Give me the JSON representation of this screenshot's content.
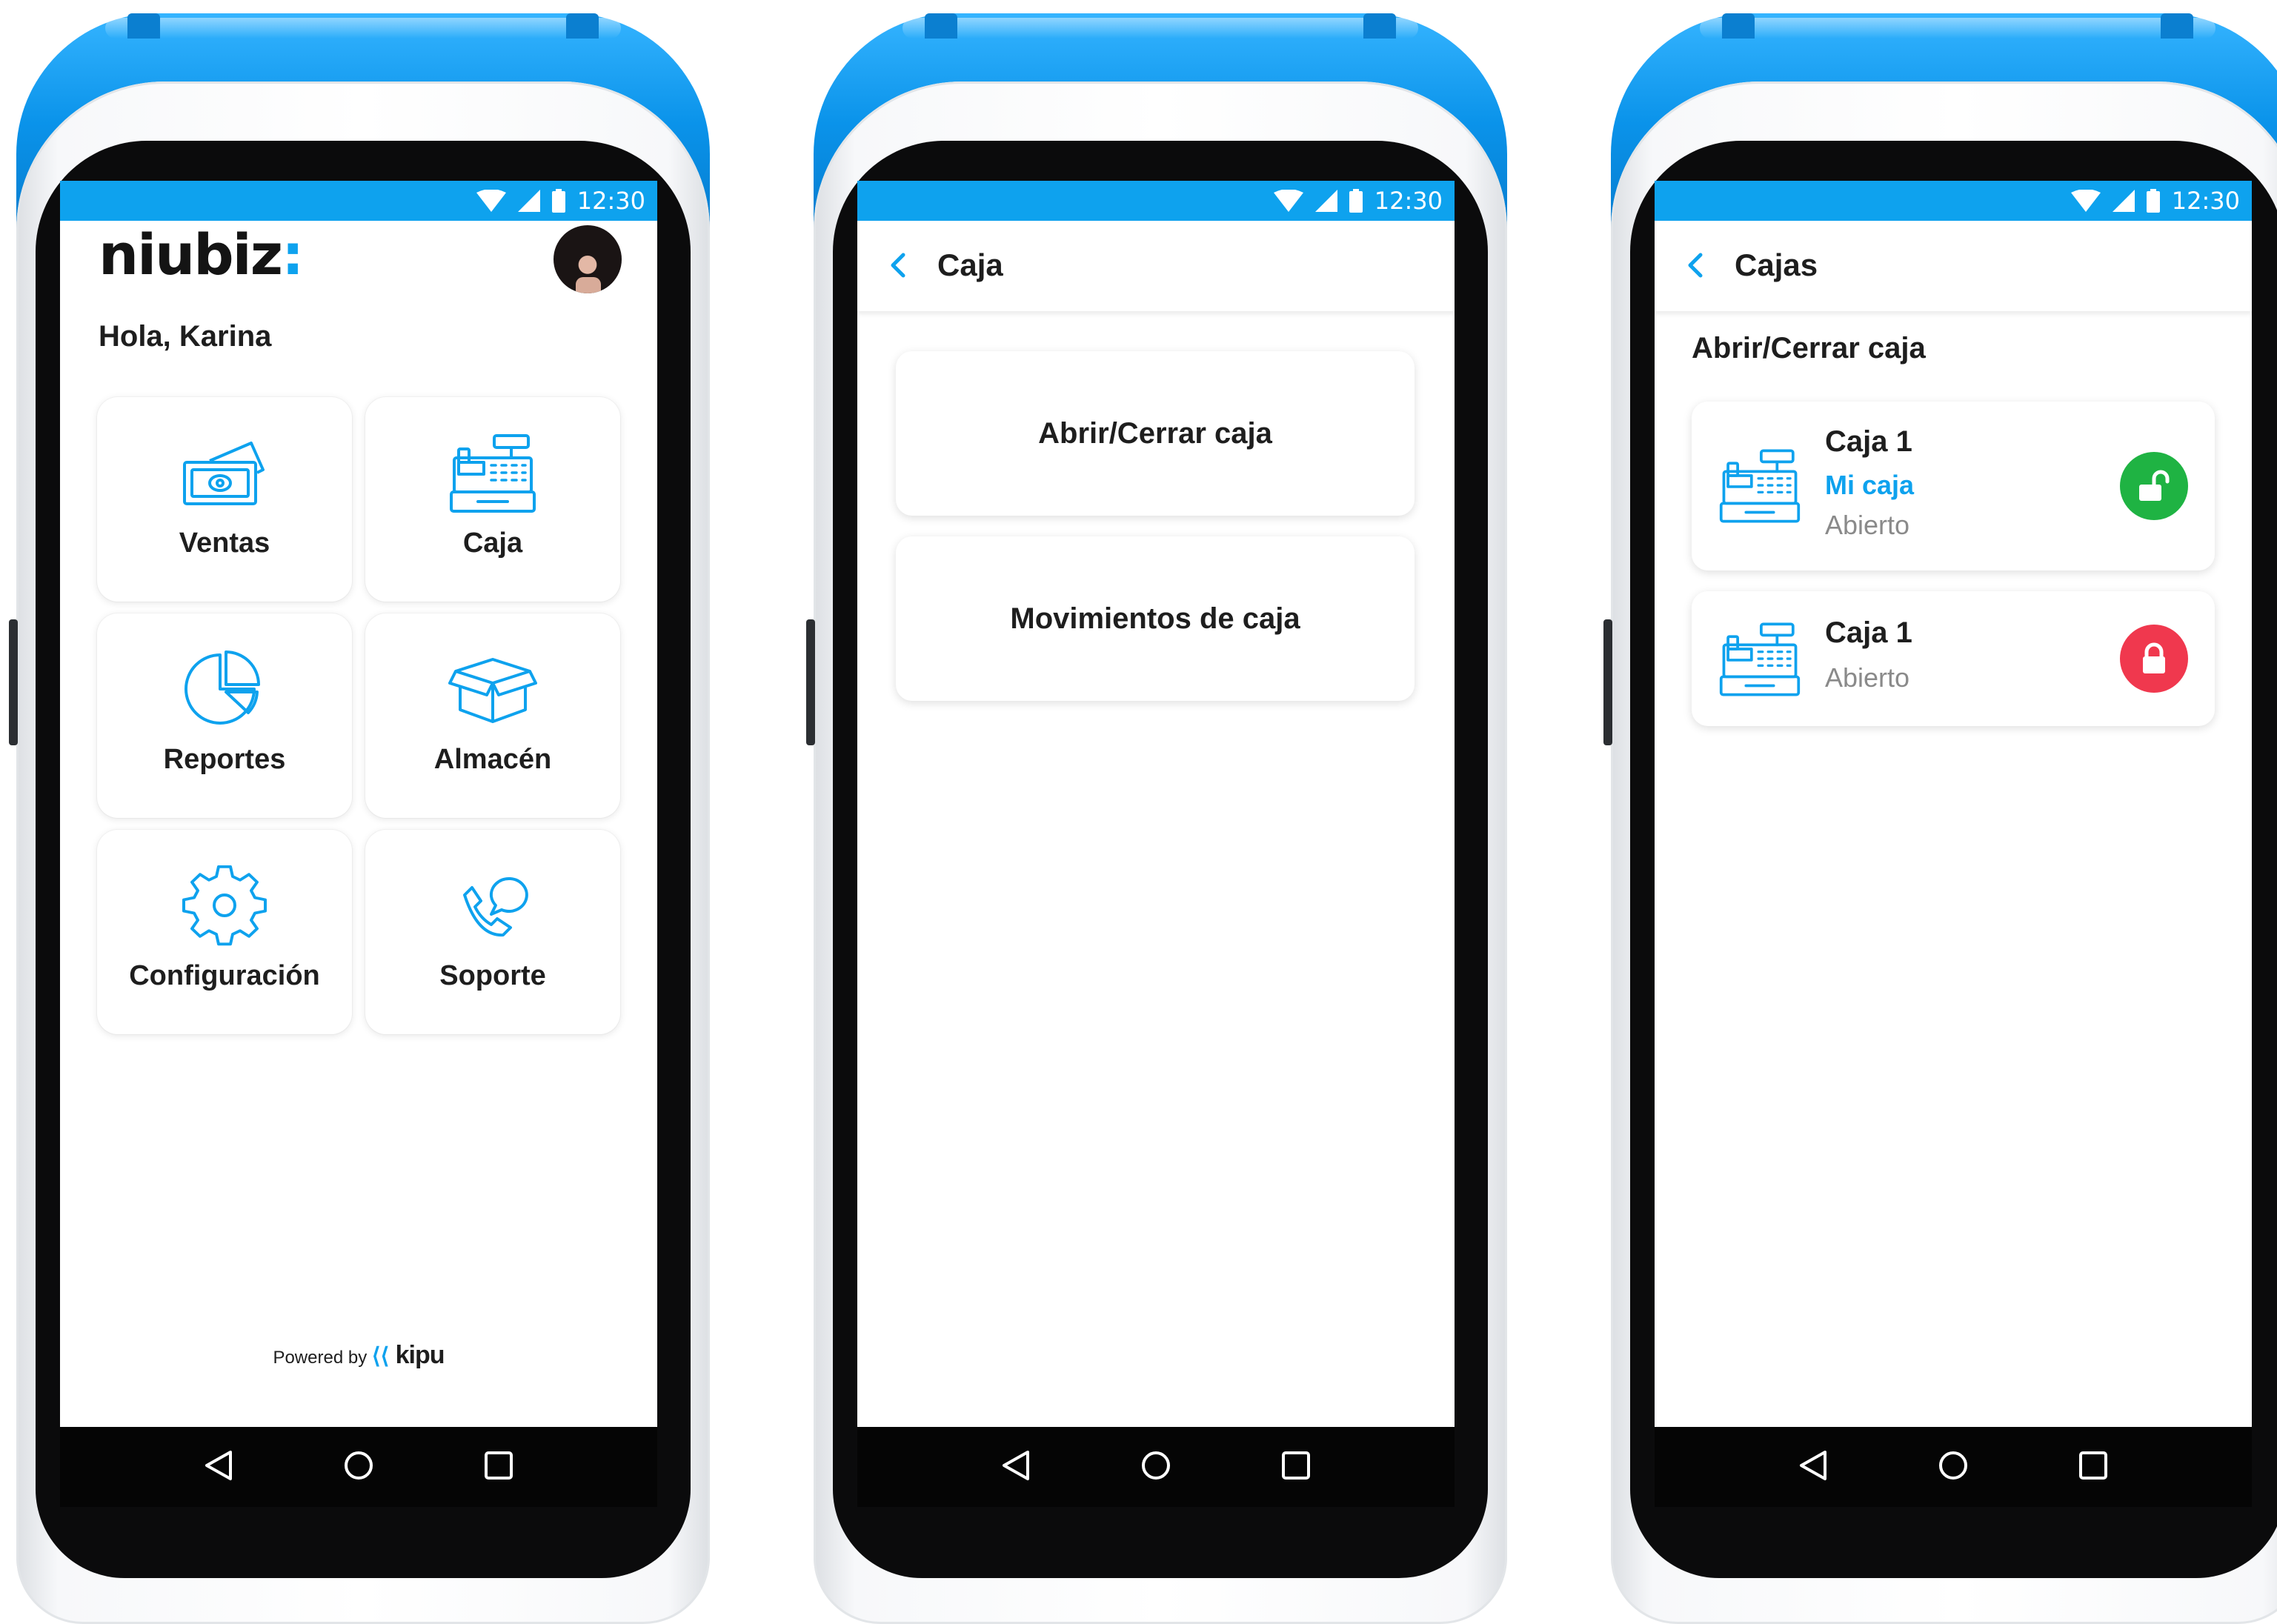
{
  "status_bar": {
    "time": "12:30"
  },
  "colors": {
    "accent": "#0ea2ee",
    "open_green": "#1fb343",
    "closed_red": "#f0384e"
  },
  "screen_home": {
    "logo": "niubiz",
    "logo_mark": ":",
    "greeting": "Hola, Karina",
    "tiles": [
      {
        "label": "Ventas",
        "icon": "money-icon"
      },
      {
        "label": "Caja",
        "icon": "cash-register-icon"
      },
      {
        "label": "Reportes",
        "icon": "pie-chart-icon"
      },
      {
        "label": "Almacén",
        "icon": "box-icon"
      },
      {
        "label": "Configuración",
        "icon": "gear-icon"
      },
      {
        "label": "Soporte",
        "icon": "phone-support-icon"
      }
    ],
    "powered_by": "Powered by",
    "powered_brand": "kipu"
  },
  "screen_caja": {
    "title": "Caja",
    "options": [
      "Abrir/Cerrar caja",
      "Movimientos de caja"
    ]
  },
  "screen_cajas": {
    "title": "Cajas",
    "section": "Abrir/Cerrar caja",
    "items": [
      {
        "name": "Caja 1",
        "tag": "Mi caja",
        "status": "Abierto",
        "lock": "unlocked-icon"
      },
      {
        "name": "Caja 1",
        "status": "Abierto",
        "lock": "locked-icon"
      }
    ]
  }
}
